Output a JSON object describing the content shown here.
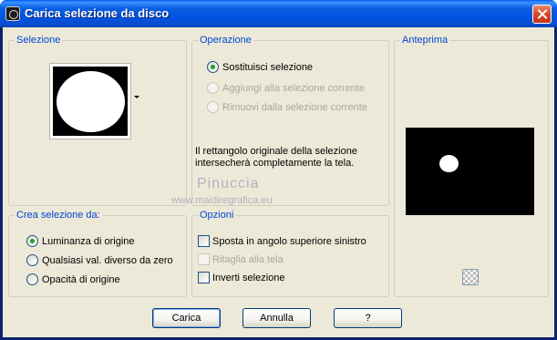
{
  "window": {
    "title": "Carica selezione da disco",
    "app_icon": "psp-icon",
    "close_icon": "close-icon"
  },
  "selezione": {
    "title": "Selezione"
  },
  "operazione": {
    "title": "Operazione",
    "options": [
      {
        "label": "Sostituisci selezione",
        "selected": true,
        "enabled": true
      },
      {
        "label": "Aggiungi alla selezione corrente",
        "selected": false,
        "enabled": false
      },
      {
        "label": "Rimuovi dalla selezione corrente",
        "selected": false,
        "enabled": false
      }
    ],
    "info_line1": "Il rettangolo originale della selezione",
    "info_line2": "intersecherà completamente la tela."
  },
  "anteprima": {
    "title": "Anteprima"
  },
  "crea": {
    "title": "Crea selezione da:",
    "options": [
      {
        "label": "Luminanza di origine",
        "selected": true
      },
      {
        "label": "Qualsiasi val. diverso da zero",
        "selected": false
      },
      {
        "label": "Opacità di origine",
        "selected": false
      }
    ]
  },
  "opzioni": {
    "title": "Opzioni",
    "checks": [
      {
        "label": "Sposta in angolo superiore sinistro",
        "checked": false,
        "enabled": true
      },
      {
        "label": "Ritaglia alla tela",
        "checked": false,
        "enabled": false
      },
      {
        "label": "Inverti selezione",
        "checked": false,
        "enabled": true
      }
    ]
  },
  "watermark": {
    "name": "Pinuccia",
    "url": "www.maidiregrafica.eu"
  },
  "buttons": {
    "load": "Carica",
    "cancel": "Annulla",
    "help": "?"
  }
}
